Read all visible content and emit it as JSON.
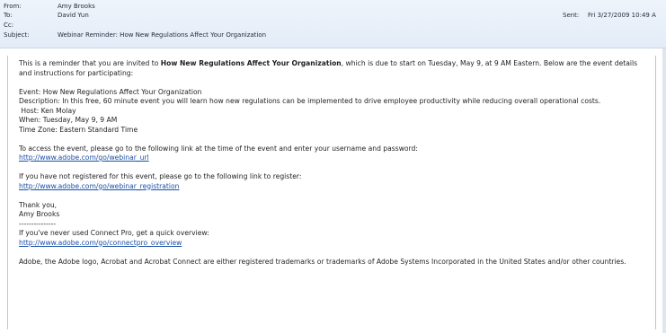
{
  "header": {
    "from_label": "From:",
    "from_value": "Amy Brooks",
    "to_label": "To:",
    "to_value": "David Yun",
    "cc_label": "Cc:",
    "cc_value": "",
    "subject_label": "Subject:",
    "subject_value": "Webinar Reminder: How New Regulations Affect Your Organization",
    "sent_label": "Sent:",
    "sent_value": "Fri 3/27/2009 10:49 A"
  },
  "body": {
    "intro_prefix": "This is a reminder that you are invited to ",
    "intro_bold": "How New Regulations Affect Your Organization",
    "intro_suffix": ", which is due to start on Tuesday, May 9, at 9 AM Eastern. Below are the event details",
    "intro_line2": "and instructions for participating:",
    "event": "Event: How New Regulations Affect Your Organization",
    "description": "Description: In this free, 60 minute event you will learn how new regulations can be implemented to drive employee productivity while reducing overall operational costs.",
    "host": " Host: Ken Molay",
    "when": "When: Tuesday, May 9, 9 AM",
    "timezone": "Time Zone: Eastern Standard Time",
    "access_text": "To access the event, please go to the following link at the time of the event and enter your username and password:",
    "access_link": "http://www.adobe.com/go/webinar_url",
    "register_text": "If you have not registered for this event, please go to the following link to register:",
    "register_link": "http://www.adobe.com/go/webinar_registration",
    "thanks": "Thank you,",
    "signature": "Amy Brooks",
    "separator": "---------------",
    "overview_text": "If you've never used Connect Pro, get a quick overview:",
    "overview_link": "http://www.adobe.com/go/connectpro_overview",
    "trademark": "Adobe, the Adobe logo, Acrobat and Acrobat Connect are either registered trademarks or trademarks of Adobe Systems Incorporated in the United States and/or other countries."
  }
}
